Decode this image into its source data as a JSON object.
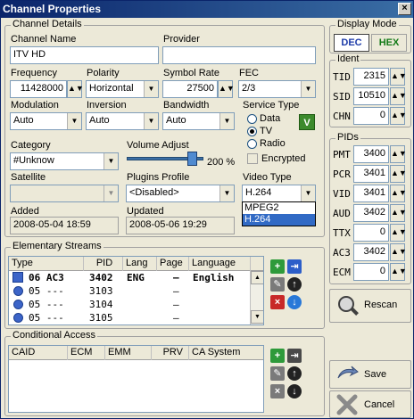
{
  "window": {
    "title": "Channel Properties",
    "close_glyph": "×"
  },
  "channel_details": {
    "legend": "Channel Details",
    "name_label": "Channel Name",
    "name_value": "ITV HD",
    "provider_label": "Provider",
    "provider_value": "",
    "frequency_label": "Frequency",
    "frequency_value": "11428000",
    "polarity_label": "Polarity",
    "polarity_value": "Horizontal",
    "symbol_rate_label": "Symbol Rate",
    "symbol_rate_value": "27500",
    "fec_label": "FEC",
    "fec_value": "2/3",
    "modulation_label": "Modulation",
    "modulation_value": "Auto",
    "inversion_label": "Inversion",
    "inversion_value": "Auto",
    "bandwidth_label": "Bandwidth",
    "bandwidth_value": "Auto",
    "service_type_label": "Service Type",
    "service_types": [
      "Data",
      "TV",
      "Radio"
    ],
    "service_type_selected": "TV",
    "encrypted_label": "Encrypted",
    "verified_icon_text": "V",
    "category_label": "Category",
    "category_value": "#Unknow",
    "volume_label": "Volume Adjust",
    "volume_value": "200 %",
    "volume_level": 0.9,
    "satellite_label": "Satellite",
    "satellite_value": "",
    "plugins_label": "Plugins Profile",
    "plugins_value": "<Disabled>",
    "video_type_label": "Video Type",
    "video_type_value": "H.264",
    "video_type_options": [
      "MPEG2",
      "H.264"
    ],
    "added_label": "Added",
    "added_value": "2008-05-04 18:59",
    "updated_label": "Updated",
    "updated_value": "2008-05-06 19:29"
  },
  "elementary_streams": {
    "legend": "Elementary Streams",
    "columns": [
      "Type",
      "PID",
      "Lang",
      "Page",
      "Language"
    ],
    "rows": [
      {
        "type": "06 AC3",
        "pid": "3402",
        "lang": "ENG",
        "page": "–",
        "language": "English"
      },
      {
        "type": "05 ---",
        "pid": "3103",
        "lang": "",
        "page": "–",
        "language": ""
      },
      {
        "type": "05 ---",
        "pid": "3104",
        "lang": "",
        "page": "–",
        "language": ""
      },
      {
        "type": "05 ---",
        "pid": "3105",
        "lang": "",
        "page": "–",
        "language": ""
      }
    ]
  },
  "conditional_access": {
    "legend": "Conditional Access",
    "columns": [
      "CAID",
      "ECM",
      "EMM",
      "PRV",
      "CA System"
    ]
  },
  "display_mode": {
    "legend": "Display Mode",
    "dec": "DEC",
    "hex": "HEX"
  },
  "ident": {
    "legend": "Ident",
    "items": [
      {
        "label": "TID",
        "value": "2315"
      },
      {
        "label": "SID",
        "value": "10510"
      },
      {
        "label": "CHN",
        "value": "0"
      }
    ]
  },
  "pids": {
    "legend": "PIDs",
    "items": [
      {
        "label": "PMT",
        "value": "3400"
      },
      {
        "label": "PCR",
        "value": "3401"
      },
      {
        "label": "VID",
        "value": "3401"
      },
      {
        "label": "AUD",
        "value": "3402"
      },
      {
        "label": "TTX",
        "value": "0"
      },
      {
        "label": "AC3",
        "value": "3402"
      },
      {
        "label": "ECM",
        "value": "0"
      }
    ]
  },
  "buttons": {
    "rescan": "Rescan",
    "save": "Save",
    "cancel": "Cancel"
  },
  "colors": {
    "title_start": "#0a246a",
    "title_end": "#3a6ea5",
    "selection": "#316ac5"
  }
}
